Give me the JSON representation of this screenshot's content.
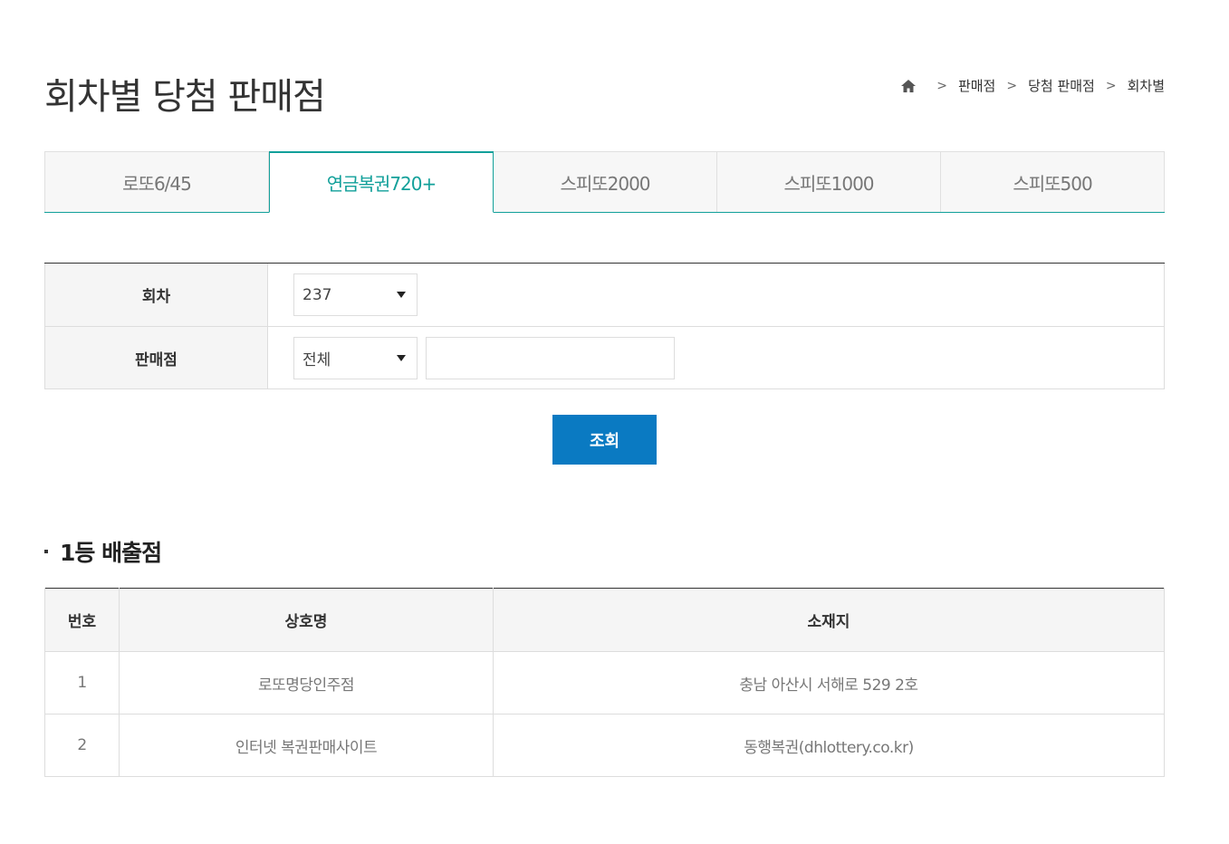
{
  "page": {
    "title": "회차별 당첨 판매점"
  },
  "breadcrumb": [
    "판매점",
    "당첨 판매점",
    "회차별"
  ],
  "tabs": [
    {
      "label": "로또6/45",
      "active": false
    },
    {
      "label": "연금복권720+",
      "active": true
    },
    {
      "label": "스피또2000",
      "active": false
    },
    {
      "label": "스피또1000",
      "active": false
    },
    {
      "label": "스피또500",
      "active": false
    }
  ],
  "search": {
    "round_label": "회차",
    "round_value": "237",
    "store_label": "판매점",
    "store_value": "전체",
    "store_query": "",
    "submit_label": "조회"
  },
  "results": {
    "title": "1등 배출점",
    "headers": {
      "no": "번호",
      "name": "상호명",
      "address": "소재지"
    },
    "rows": [
      {
        "no": "1",
        "name": "로또명당인주점",
        "address": "충남 아산시 서해로 529 2호"
      },
      {
        "no": "2",
        "name": "인터넷 복권판매사이트",
        "address": "동행복권(dhlottery.co.kr)"
      }
    ]
  },
  "colors": {
    "accent": "#12a09a",
    "button": "#0a7ac2"
  }
}
